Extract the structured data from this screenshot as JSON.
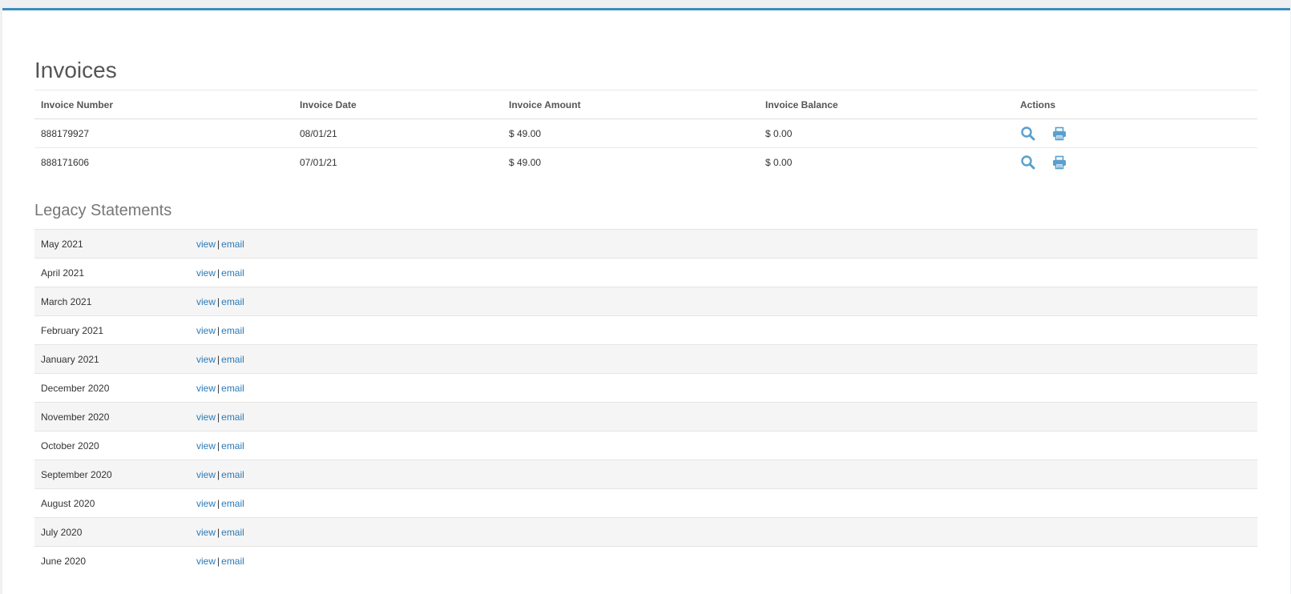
{
  "page_title": "Invoices",
  "invoices": {
    "headers": {
      "number": "Invoice Number",
      "date": "Invoice Date",
      "amount": "Invoice Amount",
      "balance": "Invoice Balance",
      "actions": "Actions"
    },
    "rows": [
      {
        "number": "888179927",
        "date": "08/01/21",
        "amount": "$ 49.00",
        "balance": "$ 0.00"
      },
      {
        "number": "888171606",
        "date": "07/01/21",
        "amount": "$ 49.00",
        "balance": "$ 0.00"
      }
    ],
    "action_icons": [
      "search-icon",
      "print-icon"
    ]
  },
  "legacy": {
    "title": "Legacy Statements",
    "view_label": "view",
    "separator": "|",
    "email_label": "email",
    "months": [
      "May 2021",
      "April 2021",
      "March 2021",
      "February 2021",
      "January 2021",
      "December 2020",
      "November 2020",
      "October 2020",
      "September 2020",
      "August 2020",
      "July 2020",
      "June 2020"
    ]
  },
  "colors": {
    "accent": "#3c8dbc",
    "link": "#2b7bb9",
    "icon": "#5a9fd0",
    "stripe": "#f5f5f5"
  }
}
